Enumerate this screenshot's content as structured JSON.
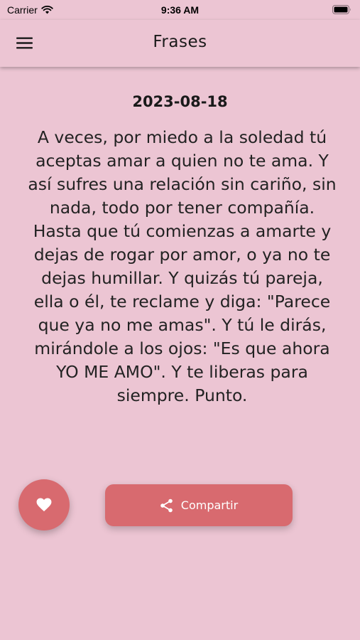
{
  "status_bar": {
    "carrier": "Carrier",
    "time": "9:36 AM"
  },
  "app_bar": {
    "title": "Frases",
    "menu_icon": "hamburger-menu-icon"
  },
  "quote": {
    "date": "2023-08-18",
    "text": "A veces, por miedo a la soledad tú aceptas amar a quien no te ama. Y así sufres una relación sin cariño, sin nada, todo por tener compañía. Hasta que tú comienzas a amarte y dejas de rogar por amor, o ya no te dejas humillar. Y quizás tú pareja, ella o él, te reclame y diga: \"Parece que ya no me amas\". Y tú le dirás, mirándole a los ojos: \"Es que ahora YO ME AMO\". Y te liberas para siempre. Punto."
  },
  "actions": {
    "favorite_icon": "heart-icon",
    "share_label": "Compartir",
    "share_icon": "share-icon"
  },
  "colors": {
    "background": "#ecc5d3",
    "accent": "#d86a6f"
  }
}
